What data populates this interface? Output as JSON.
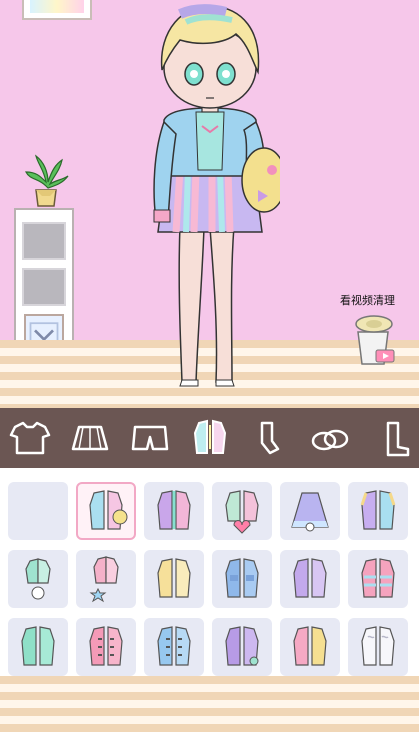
{
  "room": {
    "video_clean_label": "看视频清理"
  },
  "tabs": [
    {
      "name": "tab-tops",
      "icon": "t-shirt-icon"
    },
    {
      "name": "tab-skirts",
      "icon": "skirt-icon"
    },
    {
      "name": "tab-shorts",
      "icon": "shorts-icon"
    },
    {
      "name": "tab-jackets",
      "icon": "jacket-icon",
      "selected": true
    },
    {
      "name": "tab-socks",
      "icon": "socks-icon"
    },
    {
      "name": "tab-shoes",
      "icon": "shoes-icon"
    },
    {
      "name": "tab-more",
      "icon": "boot-icon"
    }
  ],
  "wardrobe_items": [
    {
      "icon": "empty-slot-icon"
    },
    {
      "icon": "rainbow-cardigan-icon",
      "selected": true
    },
    {
      "icon": "purple-cardigan-icon"
    },
    {
      "icon": "heart-bag-jacket-icon"
    },
    {
      "icon": "blue-cape-icon"
    },
    {
      "icon": "pastel-varsity-jacket-icon"
    },
    {
      "icon": "mint-jacket-with-charm-icon"
    },
    {
      "icon": "star-pink-jacket-icon"
    },
    {
      "icon": "yellow-jacket-icon"
    },
    {
      "icon": "denim-jacket-icon"
    },
    {
      "icon": "lilac-jacket-icon"
    },
    {
      "icon": "striped-windbreaker-icon"
    },
    {
      "icon": "mint-coat-icon"
    },
    {
      "icon": "pink-duffle-coat-icon"
    },
    {
      "icon": "blue-duffle-coat-icon"
    },
    {
      "icon": "lavender-jacket-icon"
    },
    {
      "icon": "pink-yellow-coat-icon"
    },
    {
      "icon": "white-fur-coat-icon"
    }
  ],
  "colors": {
    "wall": "#f6c7ea",
    "tab_bar": "#6b5653",
    "selected_border": "#f2a8c5",
    "item_bg": "#e7e9f4"
  }
}
